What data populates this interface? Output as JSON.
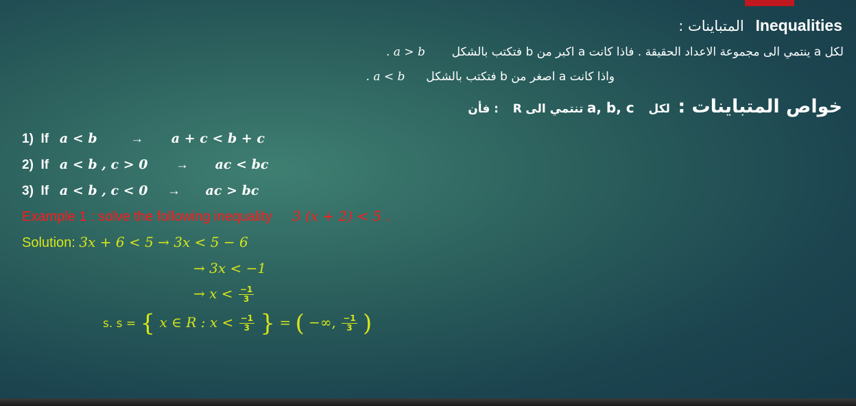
{
  "header": {
    "title_ar": "المتباينات :",
    "title_en": "Inequalities"
  },
  "definition": {
    "line1_text": "لكل a ينتمي الى مجموعة الاعداد الحقيقة . فاذا كانت a اكبر من b فتكتب بالشكل",
    "line1_math": ". a > b",
    "line2_text": "واذا كانت a اصغر من b فتكتب بالشكل",
    "line2_math": ". a < b"
  },
  "properties_heading": {
    "title": "خواص المتباينات :",
    "for_all": "لكل",
    "vars": "a, b, c",
    "belong": "تنتمي الى",
    "set": "R",
    "then": "فأن :"
  },
  "properties": [
    {
      "num": "1)",
      "word": "If",
      "condition": "a < b",
      "arrow": "→",
      "result": "a + c < b + c"
    },
    {
      "num": "2)",
      "word": "If",
      "condition": "a < b , c > 0",
      "arrow": "→",
      "result": "ac < bc"
    },
    {
      "num": "3)",
      "word": "If",
      "condition": "a < b ,  c < 0",
      "arrow": "→",
      "result": "ac > bc"
    }
  ],
  "example": {
    "label": "Example 1 : solve the following inequality",
    "expression": "3 (x + 2) < 5 ."
  },
  "solution": {
    "label": "Solution:",
    "step1": "3x + 6  < 5 → 3x < 5 − 6",
    "step2": "→ 3x < −1",
    "step3_prefix": "→ x <",
    "frac_num": "−1",
    "frac_den": "3",
    "set_label": "s. s =",
    "set_inner": "x  ∈  R :  x <",
    "interval_prefix": "−∞,",
    "equals": "="
  },
  "colors": {
    "background": "#2b5f5c",
    "accent_red": "#c0181e",
    "example_red": "#ff1a1a",
    "solution_yellow": "#d6e61a"
  }
}
